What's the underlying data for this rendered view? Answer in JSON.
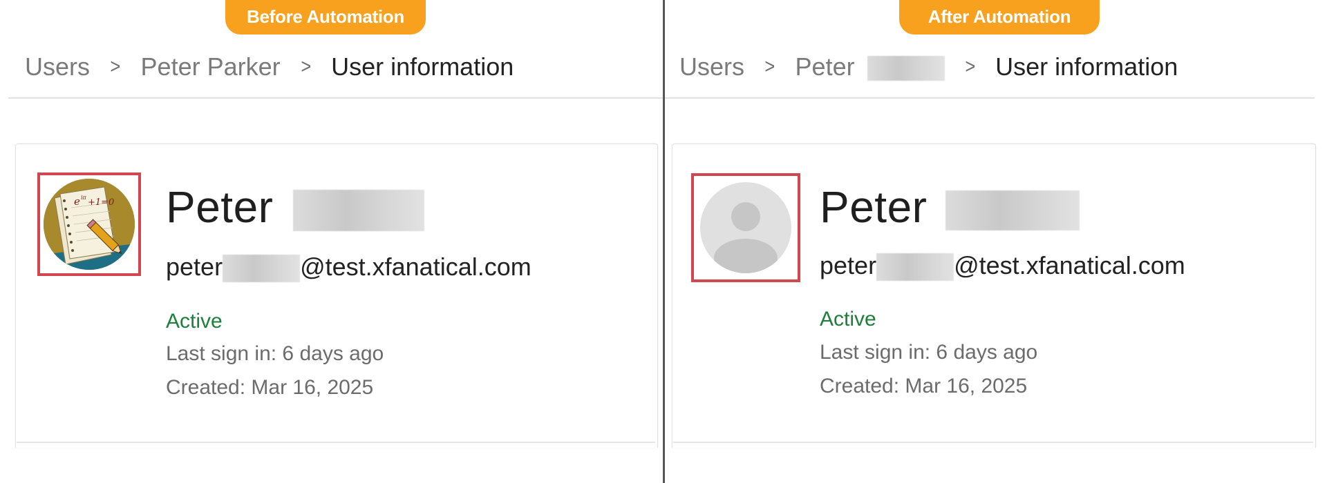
{
  "before": {
    "badge": "Before Automation",
    "breadcrumb": {
      "items": [
        "Users",
        "Peter Parker"
      ],
      "current": "User information"
    },
    "profile": {
      "first_name": "Peter",
      "email_prefix": "peter",
      "email_domain": "@test.xfanatical.com",
      "status": "Active",
      "last_sign_in": "Last sign in: 6 days ago",
      "created": "Created: Mar 16, 2025",
      "avatar_icon": "math-notebook-avatar-icon",
      "avatar_formula": "e^{iπ}+1=0"
    }
  },
  "after": {
    "badge": "After Automation",
    "breadcrumb": {
      "items": [
        "Users",
        "Peter"
      ],
      "current": "User information"
    },
    "profile": {
      "first_name": "Peter",
      "email_prefix": "peter",
      "email_domain": "@test.xfanatical.com",
      "status": "Active",
      "last_sign_in": "Last sign in: 6 days ago",
      "created": "Created: Mar 16, 2025",
      "avatar_icon": "default-person-avatar-icon"
    }
  },
  "colors": {
    "badge": "#f7a11f",
    "highlight_box": "#d2474f",
    "status_active": "#1c7f3a",
    "divider": "#555555"
  },
  "icons": {
    "breadcrumb_separator": "chevron-right-icon"
  }
}
